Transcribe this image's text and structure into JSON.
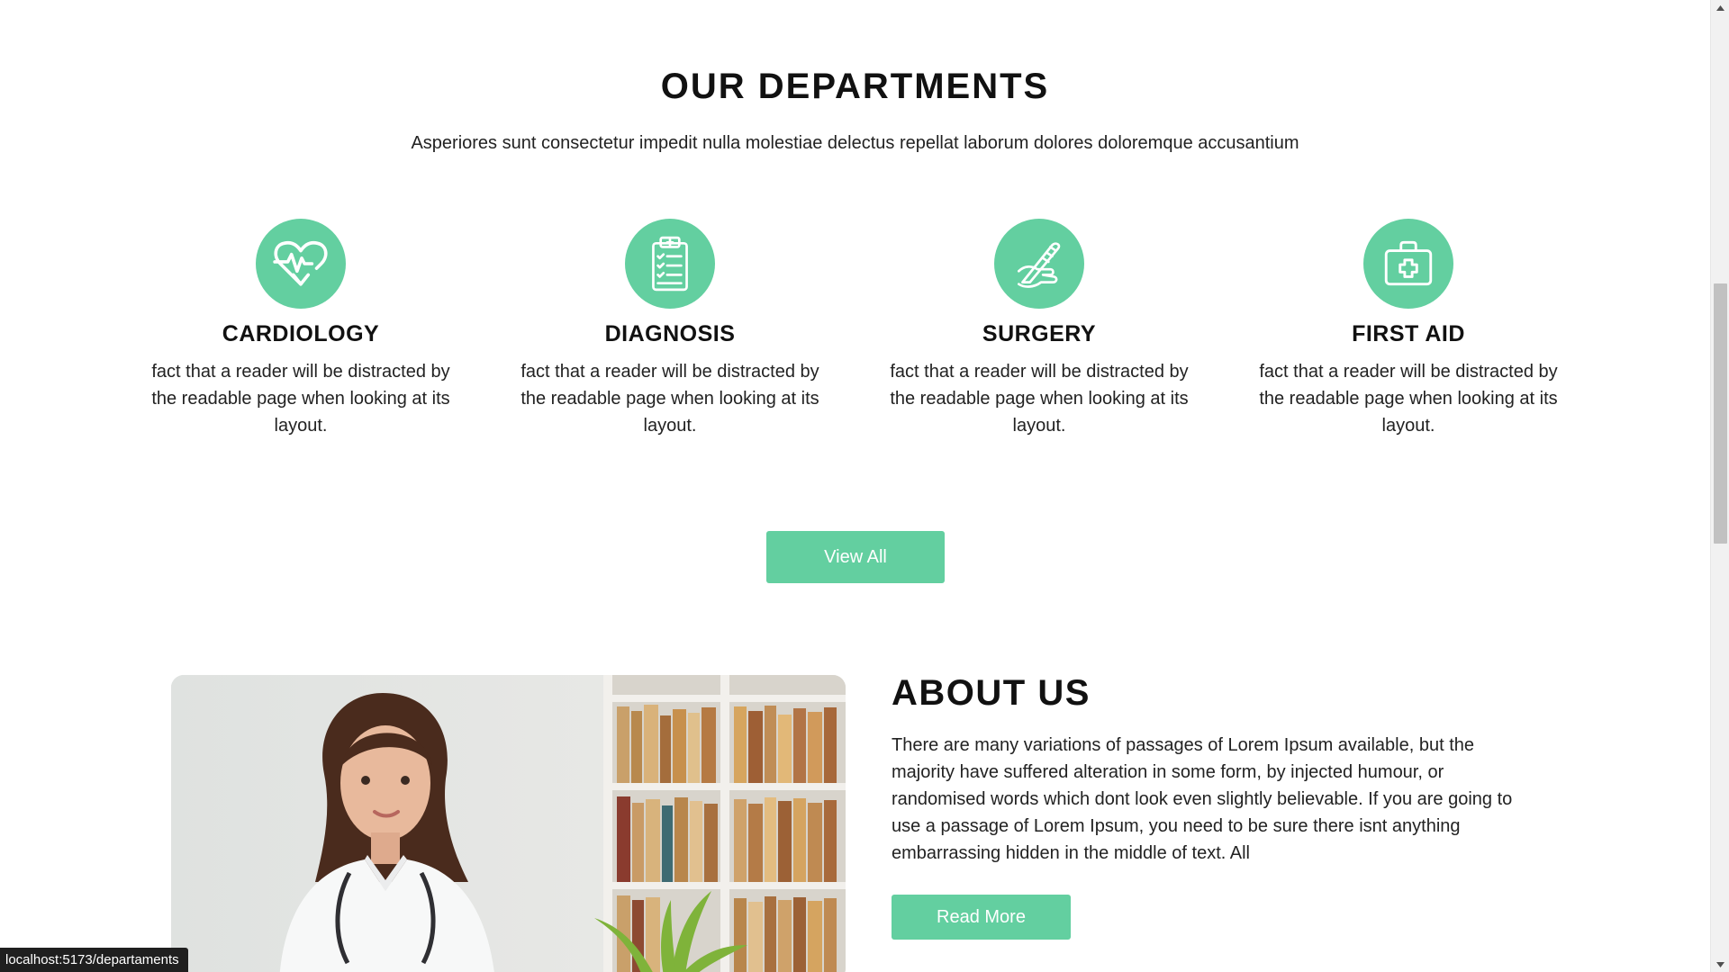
{
  "departments": {
    "title": "OUR DEPARTMENTS",
    "subtitle": "Asperiores sunt consectetur impedit nulla molestiae delectus repellat laborum dolores doloremque accusantium",
    "items": [
      {
        "name": "CARDIOLOGY",
        "icon": "heart-pulse-icon",
        "text": "fact that a reader will be distracted by the readable page when looking at its layout."
      },
      {
        "name": "DIAGNOSIS",
        "icon": "clipboard-checklist-icon",
        "text": "fact that a reader will be distracted by the readable page when looking at its layout."
      },
      {
        "name": "SURGERY",
        "icon": "scalpel-hand-icon",
        "text": "fact that a reader will be distracted by the readable page when looking at its layout."
      },
      {
        "name": "FIRST AID",
        "icon": "first-aid-kit-icon",
        "text": "fact that a reader will be distracted by the readable page when looking at its layout."
      }
    ],
    "view_all_label": "View All"
  },
  "about": {
    "title": "ABOUT US",
    "text": "There are many variations of passages of Lorem Ipsum available, but the majority have suffered alteration in some form, by injected humour, or randomised words which dont look even slightly believable. If you are going to use a passage of Lorem Ipsum, you need to be sure there isnt anything embarrassing hidden in the middle of text. All",
    "read_more_label": "Read More",
    "image": "doctor-photo"
  },
  "status_bar": {
    "url": "localhost:5173/departaments"
  },
  "colors": {
    "accent": "#63cfa0",
    "text": "#222222",
    "heading": "#111111"
  }
}
